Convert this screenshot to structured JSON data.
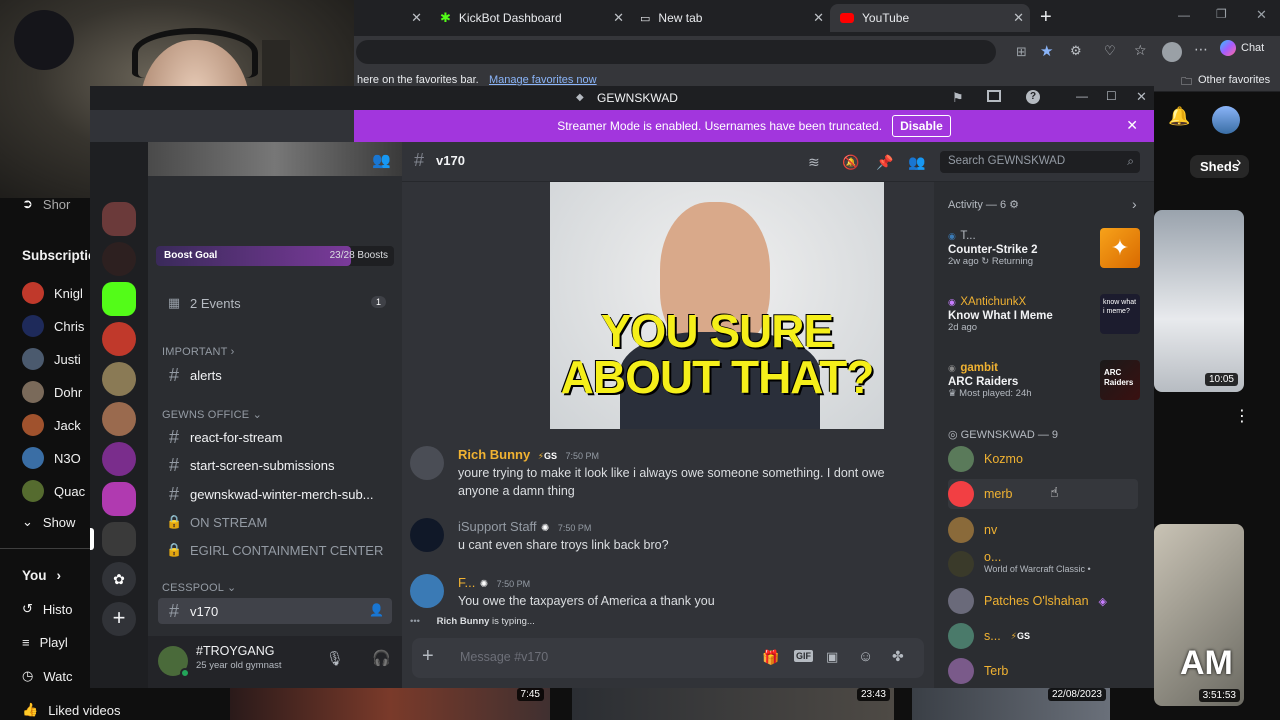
{
  "browser": {
    "tabs": [
      {
        "label": "KickBot Dashboard"
      },
      {
        "label": "New tab"
      },
      {
        "label": "YouTube"
      }
    ],
    "favorites_text": "here on the favorites bar.",
    "favorites_link": "Manage favorites now",
    "other_favorites": "Other favorites",
    "chat_label": "Chat"
  },
  "youtube": {
    "sidebar": {
      "shorts": "Shor",
      "subscriptions": "Subscriptio",
      "subs": [
        "Knigl",
        "Chris",
        "Justi",
        "Dohr",
        "Jack",
        "N3O",
        "Quac"
      ],
      "show_more": "Show",
      "you": "You",
      "history": "Histo",
      "playlists": "Playl",
      "watch_later": "Watc",
      "liked": "Liked videos"
    },
    "chip": "Sheds",
    "durations": [
      "10:05",
      "7:45",
      "23:43",
      "22/08/2023",
      "3:51:53"
    ],
    "thumb_text": "AM"
  },
  "discord": {
    "title": "GEWNSKWAD",
    "banner_text": "Streamer Mode is enabled. Usernames have been truncated.",
    "banner_button": "Disable",
    "boost": {
      "label": "Boost Goal",
      "count": "23/28 Boosts"
    },
    "events": {
      "label": "2 Events",
      "count": "1"
    },
    "categories": {
      "important": "IMPORTANT",
      "office": "GEWNS OFFICE",
      "cesspool": "CESSPOOL"
    },
    "channels": {
      "alerts": "alerts",
      "react": "react-for-stream",
      "start": "start-screen-submissions",
      "merch": "gewnskwad-winter-merch-sub...",
      "onstream": "ON STREAM",
      "egirl": "EGIRL CONTAINMENT CENTER",
      "v170": "v170"
    },
    "user": {
      "name": "#TROYGANG",
      "status": "25 year old gymnast"
    },
    "header": {
      "channel": "v170",
      "search_placeholder": "Search GEWNSKWAD"
    },
    "meme_text": [
      "YOU SURE",
      "ABOUT THAT?"
    ],
    "messages": [
      {
        "author": "Rich Bunny",
        "tag": "GS",
        "time": "7:50 PM",
        "text": "youre trying to make it look like i always owe someone something. I dont owe anyone a damn thing",
        "color": "#f0b232"
      },
      {
        "author": "iSupport Staff",
        "time": "7:50 PM",
        "text": "u cant even share troys link back bro?",
        "color": "#949ba4"
      },
      {
        "author": "F...",
        "time": "7:50 PM",
        "text": "You owe the taxpayers of America a thank you",
        "color": "#f0b232"
      }
    ],
    "typing_user": "Rich Bunny",
    "typing_text": "is typing...",
    "composer_placeholder": "Message #v170",
    "activity": {
      "title": "Activity — 6",
      "items": [
        {
          "user": "T...",
          "game": "Counter-Strike 2",
          "sub": "2w ago",
          "sub2": "Returning"
        },
        {
          "user": "XAntichunkX",
          "game": "Know What I Meme",
          "sub": "2d ago"
        },
        {
          "user": "gambit",
          "game": "ARC Raiders",
          "sub": "Most played: 24h"
        }
      ],
      "game_thumb_texts": [
        "know what i meme?",
        "ARC Raiders"
      ]
    },
    "members_title": "GEWNSKWAD — 9",
    "members": [
      {
        "name": "Kozmo"
      },
      {
        "name": "merb"
      },
      {
        "name": "nv"
      },
      {
        "name": "o...",
        "sub": "World of Warcraft Classic •"
      },
      {
        "name": "Patches O'lshahan"
      },
      {
        "name": "s...",
        "tag": "GS"
      },
      {
        "name": "Terb"
      }
    ],
    "colors": {
      "accent": "#a236dd",
      "bg": "#313338",
      "sidebar": "#2b2d31",
      "gold": "#f0b232"
    }
  }
}
